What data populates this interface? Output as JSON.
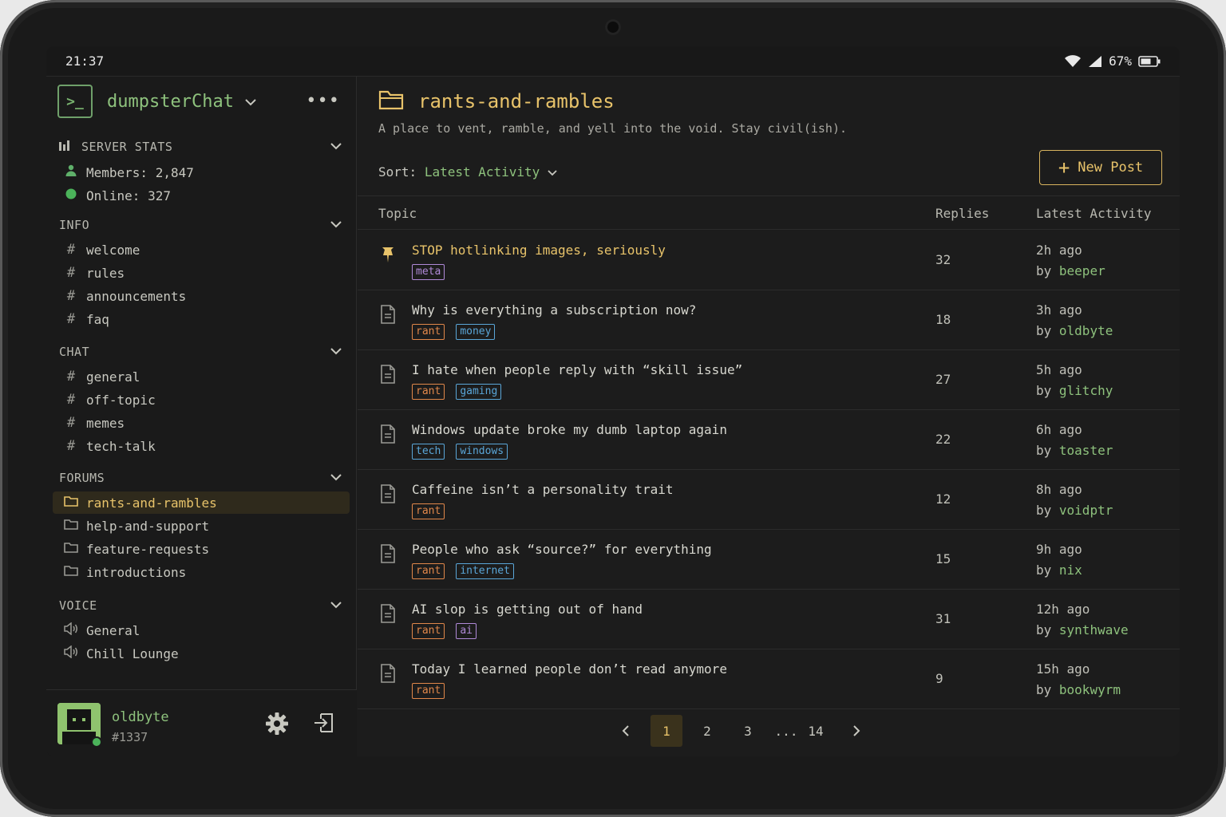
{
  "statusbar": {
    "time": "21:37",
    "battery": "67%"
  },
  "server": {
    "name": "dumpsterChat",
    "logo": ">_"
  },
  "sidebar": {
    "sections": [
      {
        "label": "SERVER STATS",
        "items": [
          {
            "icon": "user-icon",
            "label": "Members: 2,847"
          },
          {
            "icon": "online-dot-icon",
            "label": "Online: 327"
          }
        ]
      },
      {
        "label": "INFO",
        "items": [
          {
            "icon": "hash-icon",
            "label": "welcome"
          },
          {
            "icon": "hash-icon",
            "label": "rules"
          },
          {
            "icon": "hash-icon",
            "label": "announcements"
          },
          {
            "icon": "hash-icon",
            "label": "faq"
          }
        ]
      },
      {
        "label": "CHAT",
        "items": [
          {
            "icon": "hash-icon",
            "label": "general"
          },
          {
            "icon": "hash-icon",
            "label": "off-topic"
          },
          {
            "icon": "hash-icon",
            "label": "memes"
          },
          {
            "icon": "hash-icon",
            "label": "tech-talk"
          }
        ]
      },
      {
        "label": "FORUMS",
        "items": [
          {
            "icon": "folder-icon",
            "label": "rants-and-rambles",
            "active": true
          },
          {
            "icon": "folder-icon",
            "label": "help-and-support"
          },
          {
            "icon": "folder-icon",
            "label": "feature-requests"
          },
          {
            "icon": "folder-icon",
            "label": "introductions"
          }
        ]
      },
      {
        "label": "VOICE",
        "items": [
          {
            "icon": "speaker-icon",
            "label": "General"
          },
          {
            "icon": "speaker-icon",
            "label": "Chill Lounge"
          }
        ]
      }
    ]
  },
  "user": {
    "name": "oldbyte",
    "tag": "#1337",
    "status": "online"
  },
  "forum": {
    "name": "rants-and-rambles",
    "description": "A place to vent, ramble, and yell into the void. Stay civil(ish).",
    "sort_label": "Sort:",
    "sort_value": "Latest Activity",
    "new_post_label": "New Post"
  },
  "table": {
    "headers": {
      "topic": "Topic",
      "replies": "Replies",
      "activity": "Latest Activity"
    },
    "by_label": "by",
    "rows": [
      {
        "pinned": true,
        "title": "STOP hotlinking images, seriously",
        "tags": [
          "meta"
        ],
        "replies": "32",
        "when": "2h ago",
        "author": "beeper"
      },
      {
        "title": "Why is everything a subscription now?",
        "tags": [
          "rant",
          "money"
        ],
        "replies": "18",
        "when": "3h ago",
        "author": "oldbyte"
      },
      {
        "title": "I hate when people reply with “skill issue”",
        "tags": [
          "rant",
          "gaming"
        ],
        "replies": "27",
        "when": "5h ago",
        "author": "glitchy"
      },
      {
        "title": "Windows update broke my dumb laptop again",
        "tags": [
          "tech",
          "windows"
        ],
        "replies": "22",
        "when": "6h ago",
        "author": "toaster"
      },
      {
        "title": "Caffeine isn’t a personality trait",
        "tags": [
          "rant"
        ],
        "replies": "12",
        "when": "8h ago",
        "author": "voidptr"
      },
      {
        "title": "People who ask “source?” for everything",
        "tags": [
          "rant",
          "internet"
        ],
        "replies": "15",
        "when": "9h ago",
        "author": "nix"
      },
      {
        "title": "AI slop is getting out of hand",
        "tags": [
          "rant",
          "ai"
        ],
        "replies": "31",
        "when": "12h ago",
        "author": "synthwave"
      },
      {
        "title": "Today I learned people don’t read anymore",
        "tags": [
          "rant"
        ],
        "replies": "9",
        "when": "15h ago",
        "author": "bookwyrm"
      }
    ]
  },
  "tag_colors": {
    "meta": "#b08ad8",
    "rant": "#e0874a",
    "money": "#5aa6d8",
    "gaming": "#5aa6d8",
    "tech": "#5aa6d8",
    "windows": "#5aa6d8",
    "internet": "#5aa6d8",
    "ai": "#b08ad8"
  },
  "pagination": {
    "pages": [
      "1",
      "2",
      "3"
    ],
    "ellipsis": "...",
    "last": "14",
    "current": "1"
  },
  "colors": {
    "accent": "#e8c36a",
    "green": "#8ec27d",
    "background": "#1c1c1c"
  }
}
